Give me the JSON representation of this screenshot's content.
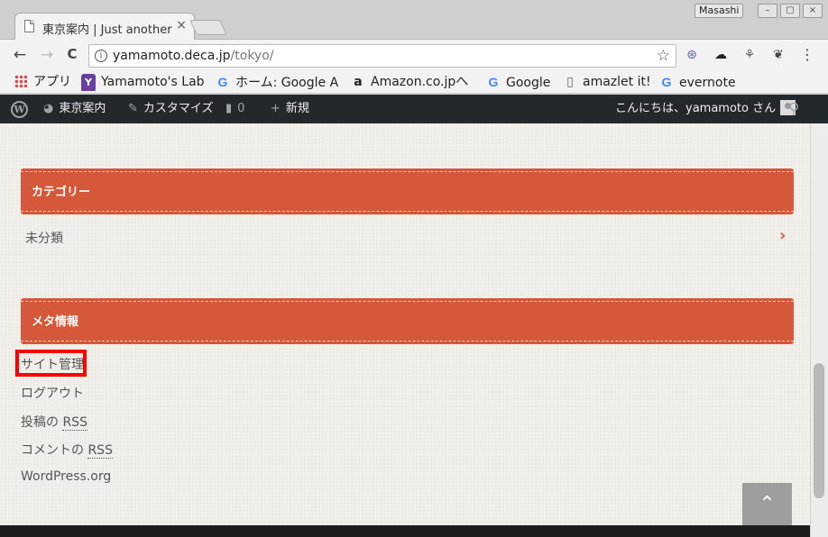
{
  "browser": {
    "tab_title": "東京案内 | Just another",
    "tab_close": "×",
    "profile_name": "Masashi",
    "window_buttons": [
      "–",
      "▢",
      "×"
    ],
    "url_host": "yamamoto.deca.jp",
    "url_path": "/tokyo/",
    "info_icon": "i",
    "star_icon": "☆",
    "menu_icon": "⋮"
  },
  "nav": {
    "back": "←",
    "forward": "→",
    "reload": "C"
  },
  "extensions": [
    "⊛",
    "☁",
    "⚘",
    "❦"
  ],
  "bookmarks": [
    {
      "icon": "apps-grid-icon",
      "label": "アプリ"
    },
    {
      "icon": "yamamoto-icon",
      "glyph": "Y",
      "label": "Yamamoto's Lab"
    },
    {
      "icon": "google-icon",
      "glyph": "G",
      "label": "ホーム: Google A"
    },
    {
      "icon": "amazon-icon",
      "glyph": "a",
      "label": "Amazon.co.jpへ"
    },
    {
      "icon": "google-icon",
      "glyph": "G",
      "label": "Google"
    },
    {
      "icon": "page-icon",
      "glyph": "▯",
      "label": "amazlet it!"
    },
    {
      "icon": "google-icon",
      "glyph": "G",
      "label": "evernote"
    }
  ],
  "admin_bar": {
    "wp_logo": "W",
    "site_name": "東京案内",
    "customize": "カスタマイズ",
    "comments_count": "0",
    "new_label": "新規",
    "greeting": "こんにちは、yamamoto さん",
    "search_icon": "⚲"
  },
  "sidebar": {
    "categories_title": "カテゴリー",
    "category_items": [
      "未分類"
    ],
    "category_chevron": "›",
    "meta_title": "メタ情報",
    "meta_links": {
      "site_admin": "サイト管理",
      "logout": "ログアウト",
      "entries_rss_prefix": "投稿の ",
      "comments_rss_prefix": "コメントの ",
      "rss": "RSS",
      "wordpress_org": "WordPress.org"
    }
  },
  "back_to_top": "⌃",
  "colors": {
    "accent": "#d5583b",
    "admin_bar": "#23282d",
    "highlight": "#ff0000"
  }
}
